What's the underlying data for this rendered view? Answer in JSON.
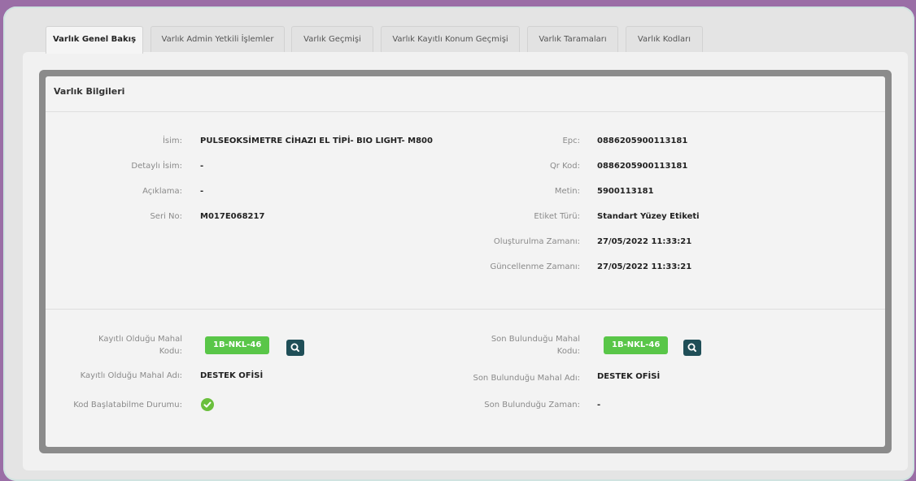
{
  "tabs": [
    {
      "label": "Varlık Genel Bakış",
      "active": true
    },
    {
      "label": "Varlık Admin Yetkili İşlemler",
      "active": false
    },
    {
      "label": "Varlık Geçmişi",
      "active": false
    },
    {
      "label": "Varlık Kayıtlı Konum Geçmişi",
      "active": false
    },
    {
      "label": "Varlık Taramaları",
      "active": false
    },
    {
      "label": "Varlık Kodları",
      "active": false
    }
  ],
  "card": {
    "title": "Varlık Bilgileri",
    "left_fields": [
      {
        "label": "İsim:",
        "value": "PULSEOKSİMETRE CİHAZI EL TİPİ- BIO LIGHT- M800"
      },
      {
        "label": "Detaylı İsim:",
        "value": "-"
      },
      {
        "label": "Açıklama:",
        "value": "-"
      },
      {
        "label": "Seri No:",
        "value": "M017E068217"
      }
    ],
    "right_fields": [
      {
        "label": "Epc:",
        "value": "0886205900113181"
      },
      {
        "label": "Qr Kod:",
        "value": "0886205900113181"
      },
      {
        "label": "Metin:",
        "value": "5900113181"
      },
      {
        "label": "Etiket Türü:",
        "value": "Standart Yüzey Etiketi"
      },
      {
        "label": "Oluşturulma Zamanı:",
        "value": "27/05/2022 11:33:21"
      },
      {
        "label": "Güncellenme Zamanı:",
        "value": "27/05/2022 11:33:21"
      }
    ],
    "location": {
      "registered_code_label_1": "Kayıtlı Olduğu Mahal",
      "registered_code_label_2": "Kodu:",
      "registered_code": "1B-NKL-46",
      "registered_name_label": "Kayıtlı Olduğu Mahal Adı:",
      "registered_name": "DESTEK OFİSİ",
      "code_start_label": "Kod Başlatabilme Durumu:",
      "last_code_label_1": "Son Bulunduğu Mahal",
      "last_code_label_2": "Kodu:",
      "last_code": "1B-NKL-46",
      "last_name_label": "Son Bulunduğu Mahal Adı:",
      "last_name": "DESTEK OFİSİ",
      "last_time_label": "Son Bulunduğu Zaman:",
      "last_time": "-"
    }
  },
  "colors": {
    "badge": "#59c648",
    "icon_button": "#1f4e57",
    "check": "#6abf3c"
  },
  "icons": {
    "search": "search-icon",
    "check": "check-circle-icon"
  }
}
